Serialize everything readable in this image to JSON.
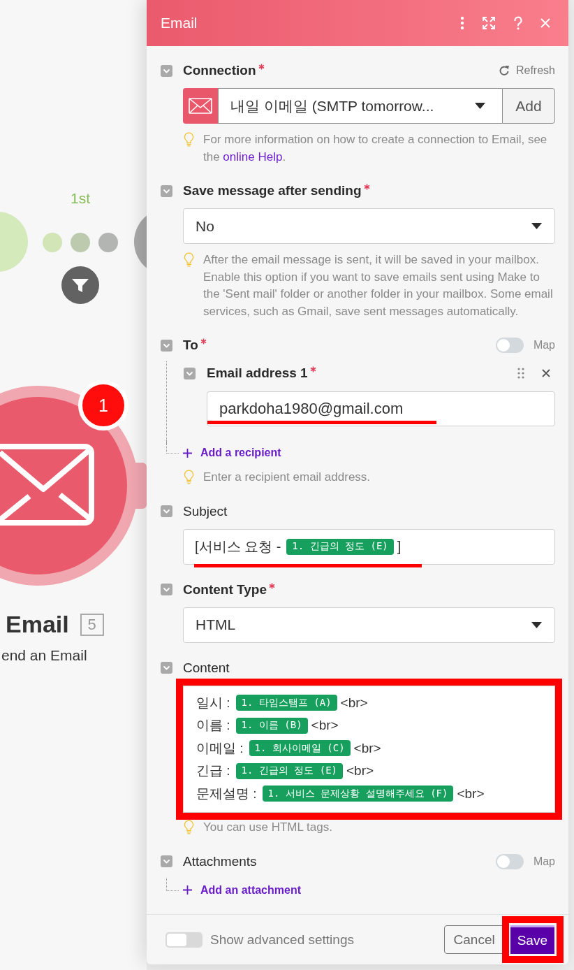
{
  "canvas": {
    "route_label": "1st",
    "module": {
      "title": "Email",
      "number": "5",
      "subtitle": "end an Email",
      "badge": "1"
    }
  },
  "panel": {
    "title": "Email"
  },
  "fields": [
    {
      "kind": "connection",
      "label": "Connection",
      "required": true,
      "expanded": true,
      "action": "Refresh",
      "value": "내일 이메일 (SMTP tomorrow...",
      "button": "Add",
      "hint": {
        "text": "For more information on how to create a connection to Email, see the ",
        "link": "online Help",
        "after": "."
      }
    },
    {
      "kind": "select",
      "label": "Save message after sending",
      "required": true,
      "expanded": true,
      "value": "No",
      "hint": {
        "text": "After the email message is sent, it will be saved in your mailbox. Enable this option if you want to save emails sent using Make to the 'Sent mail' folder or another folder in your mailbox. Some email services, such as Gmail, save sent messages automatically."
      }
    },
    {
      "kind": "array",
      "label": "To",
      "required": true,
      "expanded": true,
      "map": {
        "label": "Map",
        "on": false
      },
      "items": [
        {
          "label": "Email address 1",
          "required": true,
          "expanded": true,
          "value": "parkdoha1980@gmail.com",
          "underlined": true
        }
      ],
      "add": "Add a recipient",
      "hint": {
        "text": "Enter a recipient email address."
      }
    },
    {
      "kind": "text",
      "label": "Subject",
      "required": false,
      "expanded": true,
      "underlined": true,
      "segments": [
        {
          "kind": "text",
          "text": "[서비스 요청 -"
        },
        {
          "kind": "token",
          "text": "1. 긴급의 정도 (E)"
        },
        {
          "kind": "text",
          "text": "]"
        }
      ]
    },
    {
      "kind": "select",
      "label": "Content Type",
      "required": true,
      "expanded": true,
      "value": "HTML"
    },
    {
      "kind": "textarea",
      "label": "Content",
      "required": false,
      "expanded": true,
      "framed": true,
      "lines": [
        [
          {
            "kind": "text",
            "text": "일시 :"
          },
          {
            "kind": "token",
            "text": "1. 타임스탬프 (A)"
          },
          {
            "kind": "text",
            "text": "<br>"
          }
        ],
        [
          {
            "kind": "text",
            "text": "이름 :"
          },
          {
            "kind": "token",
            "text": "1. 이름 (B)"
          },
          {
            "kind": "text",
            "text": "<br>"
          }
        ],
        [
          {
            "kind": "text",
            "text": "이메일 :"
          },
          {
            "kind": "token",
            "text": "1. 회사이메일 (C)"
          },
          {
            "kind": "text",
            "text": "<br>"
          }
        ],
        [
          {
            "kind": "text",
            "text": "긴급 :"
          },
          {
            "kind": "token",
            "text": "1. 긴급의 정도 (E)"
          },
          {
            "kind": "text",
            "text": "<br>"
          }
        ],
        [
          {
            "kind": "text",
            "text": "문제설명 :"
          },
          {
            "kind": "token",
            "text": "1. 서비스 문제상황 설명해주세요 (F)"
          },
          {
            "kind": "text",
            "text": "<br>"
          }
        ]
      ],
      "hint": {
        "text": "You can use HTML tags."
      }
    },
    {
      "kind": "array",
      "label": "Attachments",
      "required": false,
      "expanded": true,
      "map": {
        "label": "Map",
        "on": false
      },
      "add": "Add an attachment"
    }
  ],
  "footer": {
    "advanced": {
      "label": "Show advanced settings",
      "on": false
    },
    "buttons": [
      {
        "kind": "secondary",
        "label": "Cancel",
        "framed": false
      },
      {
        "kind": "primary",
        "label": "Save",
        "framed": true
      }
    ]
  }
}
